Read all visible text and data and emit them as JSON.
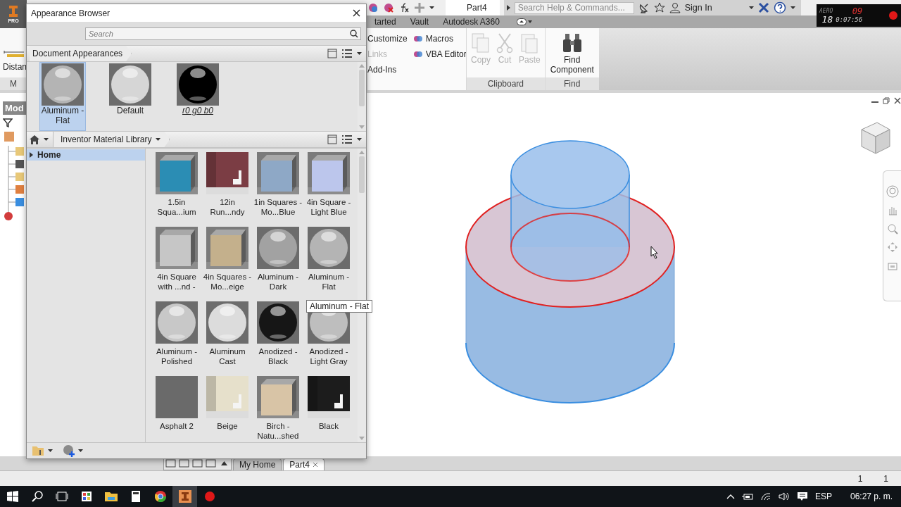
{
  "app": {
    "logo_badge": "PRO",
    "document_name": "Part4",
    "search": {
      "placeholder": "Search Help & Commands..."
    },
    "sign_in": "Sign In"
  },
  "ribbon_tabs": [
    "tarted",
    "Vault",
    "Autodesk A360"
  ],
  "ribbon": {
    "left_tool": "Distan",
    "left_panel_title": "M",
    "commands": [
      {
        "label": "Customize",
        "disabled": false,
        "kind": "plain"
      },
      {
        "label": "Macros",
        "disabled": false,
        "kind": "icon"
      },
      {
        "label": "Links",
        "disabled": true,
        "kind": "plain"
      },
      {
        "label": "VBA Editor",
        "disabled": false,
        "kind": "icon"
      },
      {
        "label": "Add-Ins",
        "disabled": false,
        "kind": "plain"
      }
    ],
    "panels": [
      {
        "title": "Clipboard",
        "buttons": [
          {
            "label": "Copy",
            "kind": "copy",
            "disabled": true
          },
          {
            "label": "Cut",
            "kind": "cut",
            "disabled": true
          },
          {
            "label": "Paste",
            "kind": "paste",
            "disabled": true
          }
        ]
      },
      {
        "title": "Find",
        "buttons": [
          {
            "label": "Find Component",
            "kind": "binoculars",
            "disabled": false
          }
        ]
      }
    ]
  },
  "recorder": {
    "mode": "AERO",
    "fps": "18",
    "counter": "09",
    "time": "0:07:56"
  },
  "model_browser": {
    "title": "Mod"
  },
  "dialog": {
    "title": "Appearance Browser",
    "search": {
      "placeholder": "Search"
    },
    "document_section": {
      "title": "Document Appearances",
      "items": [
        {
          "label": "Aluminum - Flat",
          "kind": "sphere",
          "color": "#b4b4b4",
          "selected": true,
          "underlined": false
        },
        {
          "label": "Default",
          "kind": "sphere",
          "color": "#d6d6d6",
          "selected": false,
          "underlined": false
        },
        {
          "label": "r0 g0 b0",
          "kind": "sphere",
          "color": "#000000",
          "selected": false,
          "underlined": true
        }
      ]
    },
    "library": {
      "title": "Inventor Material Library",
      "tree": [
        {
          "label": "Home",
          "selected": true
        }
      ],
      "items": [
        {
          "label": "1.5in Squa...ium",
          "kind": "cube",
          "color": "#2b8db4"
        },
        {
          "label": "12in Run...ndy",
          "kind": "room",
          "color": "#7b3d44"
        },
        {
          "label": "1in Squares - Mo...Blue",
          "kind": "cube",
          "color": "#8ea8c6"
        },
        {
          "label": "4in Square - Light Blue",
          "kind": "cube",
          "color": "#bcc6ec"
        },
        {
          "label": "4in Square with ...nd -",
          "kind": "cube",
          "color": "#c6c6c6"
        },
        {
          "label": "4in Squares - Mo...eige",
          "kind": "cube",
          "color": "#c4b08c"
        },
        {
          "label": "Aluminum - Dark",
          "kind": "sphere",
          "color": "#a2a2a2"
        },
        {
          "label": "Aluminum - Flat",
          "kind": "sphere",
          "color": "#b4b4b4"
        },
        {
          "label": "Aluminum - Polished",
          "kind": "sphere",
          "color": "#c8c8c8"
        },
        {
          "label": "Aluminum Cast",
          "kind": "sphere",
          "color": "#dcdcdc"
        },
        {
          "label": "Anodized - Black",
          "kind": "sphere",
          "color": "#161616"
        },
        {
          "label": "Anodized - Light Gray",
          "kind": "sphere",
          "color": "#bebebe"
        },
        {
          "label": "Asphalt 2",
          "kind": "flat",
          "color": "#6a6a6a"
        },
        {
          "label": "Beige",
          "kind": "room",
          "color": "#e6e0cb"
        },
        {
          "label": "Birch - Natu...shed",
          "kind": "cube",
          "color": "#d8c4a6"
        },
        {
          "label": "Black",
          "kind": "room",
          "color": "#1c1c1c"
        }
      ]
    }
  },
  "tooltip": "Aluminum - Flat",
  "document_tabs": [
    {
      "label": "My Home",
      "selected": false
    },
    {
      "label": "Part4",
      "selected": true
    }
  ],
  "status_bar": [
    "1",
    "1"
  ],
  "taskbar": {
    "language": "ESP",
    "clock": "06:27 p. m."
  }
}
